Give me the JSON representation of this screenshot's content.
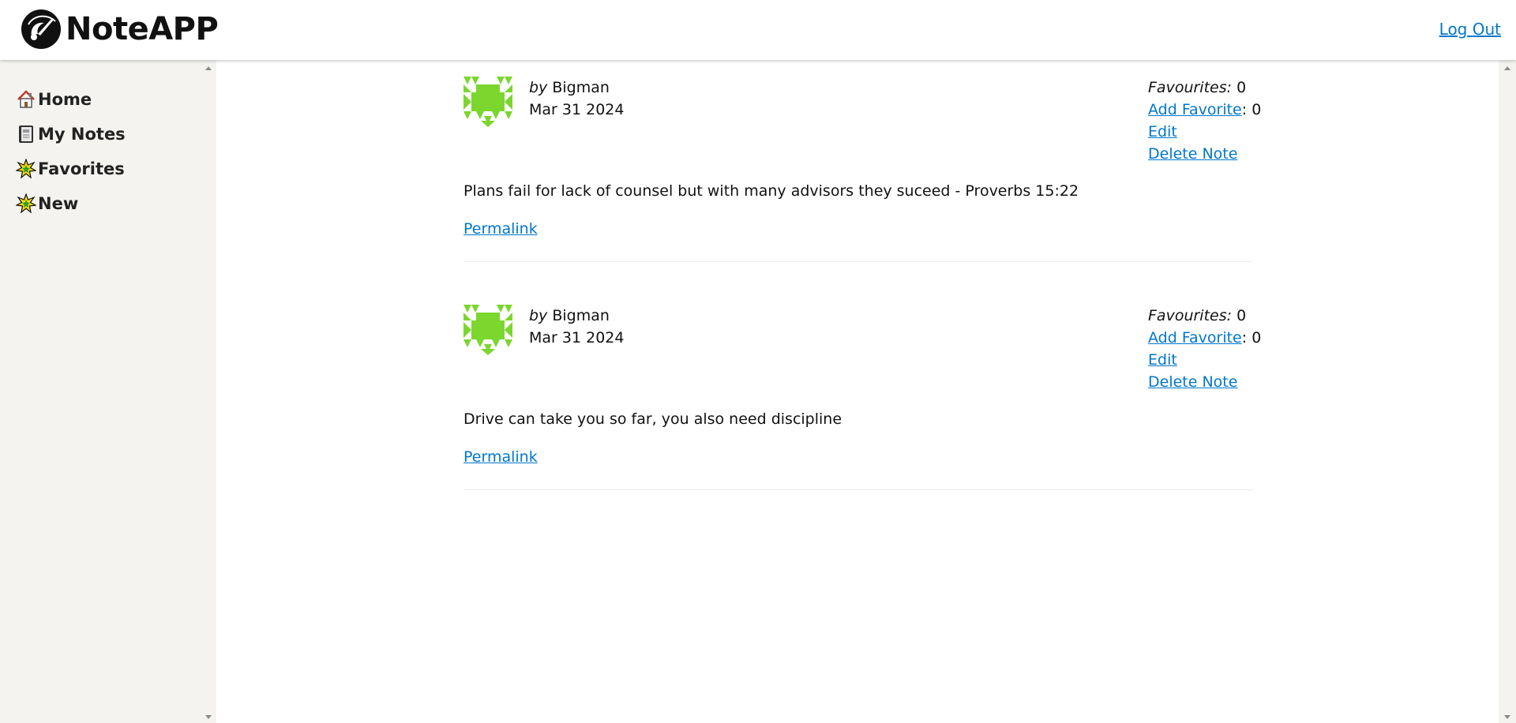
{
  "header": {
    "title": "NoteAPP",
    "logout_label": "Log Out"
  },
  "sidebar": {
    "items": [
      {
        "label": "Home",
        "icon": "house-icon"
      },
      {
        "label": "My Notes",
        "icon": "notebook-icon"
      },
      {
        "label": "Favorites",
        "icon": "star-burst-icon"
      },
      {
        "label": "New",
        "icon": "star-burst-icon"
      }
    ]
  },
  "colors": {
    "link": "#0077cc",
    "avatar": "#7bd62e",
    "sidebar_bg": "#f4f3f0"
  },
  "notes": [
    {
      "by_prefix": "by",
      "author": "Bigman",
      "date": "Mar 31 2024",
      "favourites_label": "Favourites:",
      "favourites_count": "0",
      "add_favorite_label": "Add Favorite",
      "add_favorite_count": ": 0",
      "edit_label": "Edit",
      "delete_label": "Delete Note",
      "content": "Plans fail for lack of counsel but with many advisors they suceed - Proverbs 15:22",
      "permalink_label": "Permalink"
    },
    {
      "by_prefix": "by",
      "author": "Bigman",
      "date": "Mar 31 2024",
      "favourites_label": "Favourites:",
      "favourites_count": "0",
      "add_favorite_label": "Add Favorite",
      "add_favorite_count": ": 0",
      "edit_label": "Edit",
      "delete_label": "Delete Note",
      "content": "Drive can take you so far, you also need discipline",
      "permalink_label": "Permalink"
    }
  ]
}
